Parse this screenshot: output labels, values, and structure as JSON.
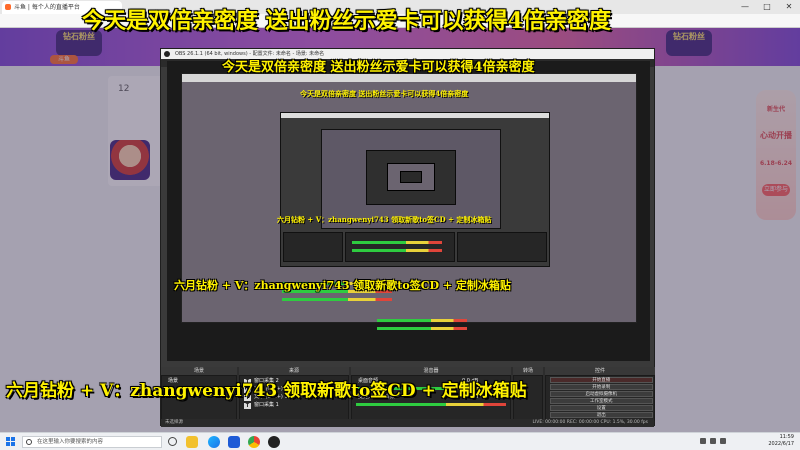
{
  "browser": {
    "tab_title": "斗鱼 | 每个人的直播平台",
    "minimize": "—",
    "maximize": "□",
    "close": "✕"
  },
  "webpage": {
    "banner_left": "钻石粉丝",
    "banner_right": "钻石粉丝",
    "logo": "斗鱼",
    "left_count": "12",
    "right_ad_lines": [
      "新生代",
      "心动开播",
      "6.18-6.24"
    ],
    "right_ad_button": "立即参与"
  },
  "obs": {
    "title": "OBS 26.1.1 (64 bit, windows) - 配置文件: 未命名 - 场景: 未命名",
    "docks": {
      "scenes_header": "场景",
      "sources_header": "来源",
      "mixer_header": "混音器",
      "transitions_header": "转场",
      "controls_header": "控件"
    },
    "scenes": [
      "场景"
    ],
    "sources": [
      {
        "icon": "T",
        "name": "窗口采集 2"
      },
      {
        "icon": "T",
        "name": "文本 (GDI+) 11"
      },
      {
        "icon": "T",
        "name": "文本 (GDI+) 10"
      },
      {
        "icon": "T",
        "name": "窗口采集 1"
      }
    ],
    "mixer": [
      {
        "name": "桌面音频",
        "level": "0.0 dB"
      },
      {
        "name": "麦克风/辅助音频",
        "level": "0.0 dB"
      }
    ],
    "controls": [
      "开始直播",
      "开始录制",
      "启动虚拟摄像机",
      "工作室模式",
      "设置",
      "退出"
    ],
    "status": "LIVE: 00:00:00   REC: 00:00:00   CPU: 1.5%, 30.00 fps",
    "preview_label": "未选择源"
  },
  "captions": {
    "top": "今天是双倍亲密度 送出粉丝示爱卡可以获得4倍亲密度",
    "promo": "六月钻粉 + V：zhangwenyi743 领取新歌to签CD + 定制冰箱贴"
  },
  "taskbar": {
    "search_placeholder": "在这里输入你要搜索的内容",
    "time": "11:59",
    "date": "2022/6/17"
  }
}
